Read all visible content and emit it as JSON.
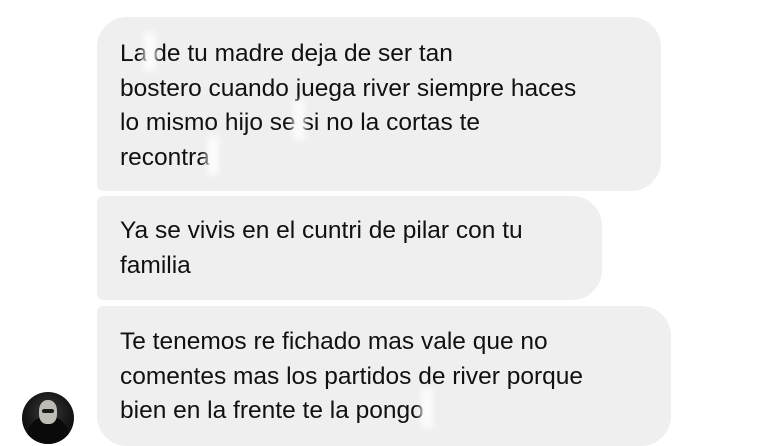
{
  "messages": [
    {
      "lines": [
        {
          "a": "La",
          "b": "de tu madre deja de ser tan"
        },
        {
          "a": "bostero cuando juega river siempre haces"
        },
        {
          "a": "lo mismo hijo se",
          "b": "si no la cortas te"
        },
        {
          "a": "recontra"
        }
      ]
    },
    {
      "lines": [
        {
          "a": "Ya se vivis en el cuntri de pilar con tu"
        },
        {
          "a": "familia"
        }
      ]
    },
    {
      "lines": [
        {
          "a": "Te tenemos re fichado mas vale que no"
        },
        {
          "a": "comentes mas los partidos de river porque"
        },
        {
          "a": "bien en la frente te la pongo"
        }
      ]
    }
  ],
  "sender": {
    "avatar_icon": "masked-figure-avatar-icon"
  },
  "colors": {
    "bubble_background": "#efefef",
    "text": "#111111",
    "page_background": "#ffffff",
    "avatar_background": "#161616"
  }
}
